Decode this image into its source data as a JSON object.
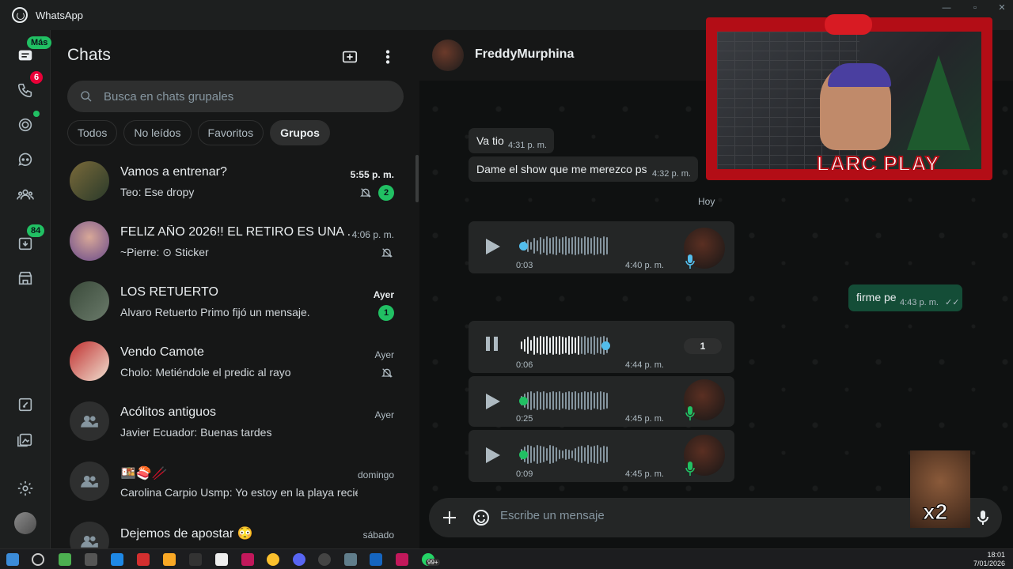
{
  "app": {
    "title": "WhatsApp"
  },
  "rail": {
    "chats_badge": "Más",
    "calls_badge": "6",
    "archive_badge": "84"
  },
  "chatlist": {
    "title": "Chats",
    "search_placeholder": "Busca en chats grupales",
    "filters": [
      "Todos",
      "No leídos",
      "Favoritos",
      "Grupos"
    ],
    "active_filter": "Grupos",
    "rows": [
      {
        "name": "Vamos a entrenar?",
        "preview": "Teo: Ese dropy",
        "time": "5:55 p. m.",
        "unread": "2",
        "muted": true
      },
      {
        "name": "FELIZ AÑO 2026!! EL RETIRO ES UNA ...",
        "preview": "~Pierre: ⊙ Sticker",
        "time": "4:06 p. m.",
        "unread": "",
        "muted": true
      },
      {
        "name": "LOS RETUERTO",
        "preview": "Alvaro Retuerto Primo fijó un mensaje.",
        "time": "Ayer",
        "unread": "1",
        "muted": false
      },
      {
        "name": "Vendo Camote",
        "preview": "Cholo: Metiéndole el predic al rayo",
        "time": "Ayer",
        "unread": "",
        "muted": true
      },
      {
        "name": "Acólitos antiguos",
        "preview": "Javier Ecuador: Buenas tardes",
        "time": "Ayer",
        "unread": "",
        "muted": false
      },
      {
        "name": "🍱🍣🥢",
        "preview": "Carolina Carpio Usmp: Yo estoy en la playa recién reg...",
        "time": "domingo",
        "unread": "",
        "muted": false
      },
      {
        "name": "Dejemos de apostar 😳",
        "preview": "",
        "time": "sábado",
        "unread": "",
        "muted": false
      }
    ]
  },
  "conversation": {
    "contact": "FreddyMurphina",
    "messages": [
      {
        "text": "Va tio",
        "time": "4:31 p. m."
      },
      {
        "text": "Dame el show que me merezco ps",
        "time": "4:32 p. m."
      }
    ],
    "day_separator": "Hoy",
    "voice_1": {
      "duration": "0:03",
      "time": "4:40 p. m."
    },
    "outgoing": {
      "text": "firme pe",
      "time": "4:43 p. m."
    },
    "voice_2": {
      "duration": "0:06",
      "time": "4:44 p. m.",
      "speed": "1"
    },
    "voice_3": {
      "duration": "0:25",
      "time": "4:45 p. m."
    },
    "voice_4": {
      "duration": "0:09",
      "time": "4:45 p. m."
    },
    "composer_placeholder": "Escribe un mensaje"
  },
  "overlay": {
    "brand": "LARC PLAY",
    "meme_label": "x2"
  },
  "taskbar": {
    "time": "18:01",
    "date": "7/01/2026",
    "wa_badge": "99+"
  }
}
